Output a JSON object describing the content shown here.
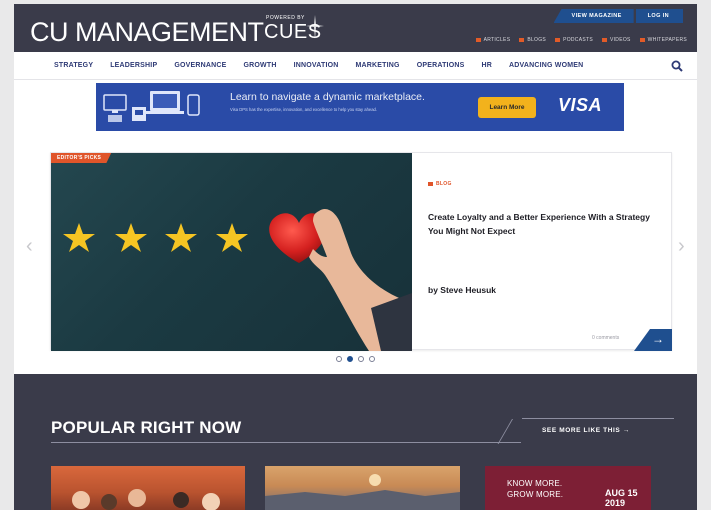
{
  "header": {
    "logo": "CU MANAGEMENT",
    "powered_by_small": "POWERED BY",
    "powered_by_brand": "CUES",
    "view_magazine": "VIEW MAGAZINE",
    "log_in": "LOG IN",
    "section_links": [
      "ARTICLES",
      "BLOGS",
      "PODCASTS",
      "VIDEOS",
      "WHITEPAPERS"
    ]
  },
  "nav": {
    "items": [
      "STRATEGY",
      "LEADERSHIP",
      "GOVERNANCE",
      "GROWTH",
      "INNOVATION",
      "MARKETING",
      "OPERATIONS",
      "HR",
      "ADVANCING WOMEN"
    ]
  },
  "ad": {
    "headline": "Learn to navigate a dynamic marketplace.",
    "subtext": "Visa DPS has the expertise, innovation, and excellence to help you stay ahead.",
    "button": "Learn More",
    "brand": "VISA"
  },
  "carousel": {
    "tag": "EDITOR'S PICKS",
    "category": "BLOG",
    "headline": "Create Loyalty and a Better Experience With a Strategy You Might Not Expect",
    "byline": "by Steve Heusuk",
    "comments": "0 comments",
    "go": "→",
    "prev": "‹",
    "next": "›",
    "active_slide": 2,
    "slide_count": 4
  },
  "popular": {
    "title": "POPULAR RIGHT NOW",
    "see_more": "SEE MORE LIKE THIS →",
    "promo_text_1": "KNOW MORE.",
    "promo_text_2": "GROW MORE.",
    "promo_date_1": "AUG 15",
    "promo_date_2": "2019"
  },
  "colors": {
    "header_bg": "#3a3b4a",
    "accent_blue": "#1f4f8f",
    "accent_orange": "#e0552a",
    "nav_text": "#2e3a75",
    "ad_bg": "#2a4ba7",
    "ad_button": "#f2b21c"
  }
}
